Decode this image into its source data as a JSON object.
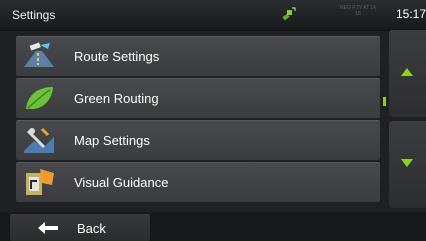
{
  "header": {
    "title": "Settings",
    "clock": "15:17",
    "status_text": "REG PTY\nAT 14 18",
    "gps_icon": "satellite-icon"
  },
  "menu": {
    "items": [
      {
        "label": "Route Settings",
        "icon": "route-settings-icon"
      },
      {
        "label": "Green Routing",
        "icon": "leaf-icon"
      },
      {
        "label": "Map Settings",
        "icon": "map-settings-icon"
      },
      {
        "label": "Visual Guidance",
        "icon": "visual-guidance-icon"
      }
    ]
  },
  "scroll": {
    "up_icon": "arrow-up-icon",
    "down_icon": "arrow-down-icon",
    "indicator_color": "#8bd41e"
  },
  "footer": {
    "back_label": "Back",
    "back_icon": "arrow-left-icon"
  },
  "colors": {
    "accent_green": "#8bd41e",
    "item_bg": "#424448",
    "background": "#1e2024"
  }
}
